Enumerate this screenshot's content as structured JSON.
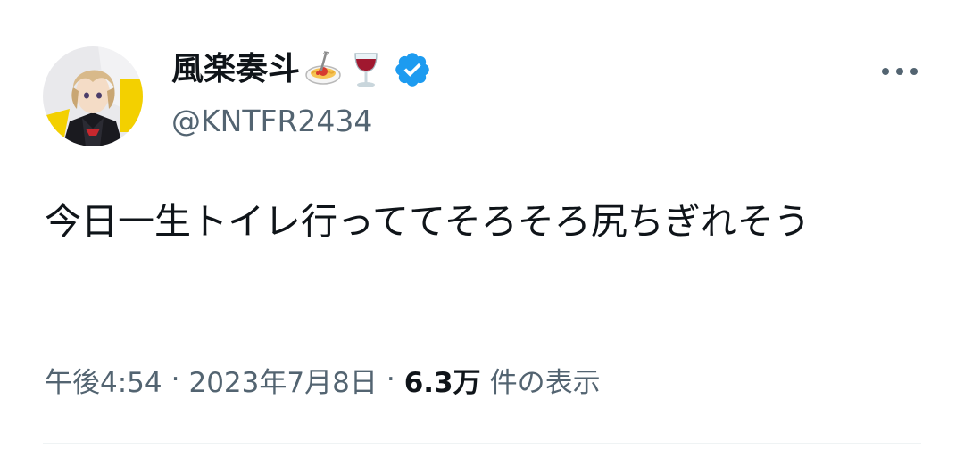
{
  "user": {
    "display_name": "風楽奏斗",
    "name_emojis": [
      "spaghetti-emoji",
      "wine-glass-emoji"
    ],
    "handle": "@KNTFR2434",
    "verified_color": "#1d9bf0"
  },
  "menu": {
    "more_icon": "more-horizontal-icon"
  },
  "tweet": {
    "text": "今日一生トイレ行っててそろそろ尻ちぎれそう"
  },
  "meta": {
    "time": "午後4:54",
    "separator": "·",
    "date": "2023年7月8日",
    "views_count": "6.3万",
    "views_label": "件の表示"
  },
  "colors": {
    "text_primary": "#0f1419",
    "text_secondary": "#536471",
    "accent": "#1d9bf0",
    "divider": "#eff3f4"
  }
}
